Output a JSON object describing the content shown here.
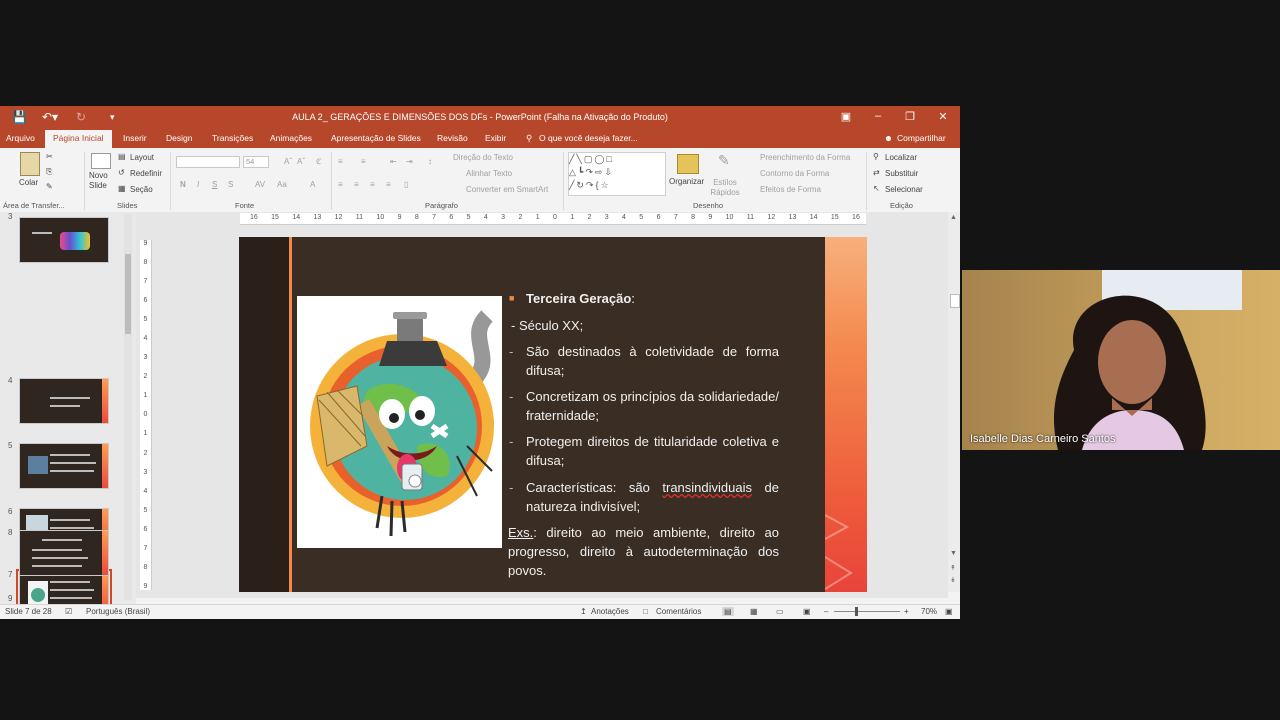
{
  "window": {
    "title": "AULA 2_ GERAÇÕES E DIMENSÕES DOS DFs - PowerPoint (Falha na Ativação do Produto)"
  },
  "menu": {
    "tabs": [
      "Arquivo",
      "Página Inicial",
      "Inserir",
      "Design",
      "Transições",
      "Animações",
      "Apresentação de Slides",
      "Revisão",
      "Exibir"
    ],
    "tell_me": "O que você deseja fazer...",
    "share": "Compartilhar"
  },
  "ribbon": {
    "clipboard": {
      "paste": "Colar",
      "group": "Área de Transfer..."
    },
    "slides": {
      "new_slide": "Novo Slide",
      "layout": "Layout",
      "reset": "Redefinir",
      "section": "Seção",
      "group": "Slides"
    },
    "font": {
      "size": "54",
      "buttons": [
        "N",
        "I",
        "S",
        "S",
        "AV",
        "Aa",
        "A"
      ],
      "group": "Fonte"
    },
    "paragraph": {
      "text_direction": "Direção do Texto",
      "align_text": "Alinhar Texto",
      "smartart": "Converter em SmartArt",
      "group": "Parágrafo"
    },
    "drawing": {
      "arrange": "Organizar",
      "quick_styles": "Estilos Rápidos",
      "fill": "Preenchimento da Forma",
      "outline": "Contorno da Forma",
      "effects": "Efeitos de Forma",
      "group": "Desenho"
    },
    "editing": {
      "find": "Localizar",
      "replace": "Substituir",
      "select": "Selecionar",
      "group": "Edição"
    }
  },
  "ruler": {
    "ticks": [
      "16",
      "15",
      "14",
      "13",
      "12",
      "11",
      "10",
      "9",
      "8",
      "7",
      "6",
      "5",
      "4",
      "3",
      "2",
      "1",
      "0",
      "1",
      "2",
      "3",
      "4",
      "5",
      "6",
      "7",
      "8",
      "9",
      "10",
      "11",
      "12",
      "13",
      "14",
      "15",
      "16"
    ],
    "vticks": [
      "9",
      "8",
      "7",
      "6",
      "5",
      "4",
      "3",
      "2",
      "1",
      "0",
      "1",
      "2",
      "3",
      "4",
      "5",
      "6",
      "7",
      "8",
      "9"
    ]
  },
  "thumbnails": {
    "numbers": [
      "3",
      "4",
      "5",
      "6",
      "7",
      "8",
      "9"
    ],
    "selected": "7"
  },
  "slide": {
    "heading": "Terceira Geração",
    "heading_suffix": ":",
    "century": "-  Século XX;",
    "items": [
      {
        "dash": "-",
        "text": "São destinados à coletividade de forma difusa;"
      },
      {
        "dash": "-",
        "text": "Concretizam os princípios da solidariedade/ fraternidade;"
      },
      {
        "dash": "-",
        "text": "Protegem direitos de titularidade coletiva e difusa;"
      },
      {
        "dash": "-",
        "text_a": "Características: são ",
        "text_b": "transindividuais",
        "text_c": " de natureza indivisível;"
      }
    ],
    "example_label": "Exs.",
    "example_text": ": direito ao meio ambiente, direito ao progresso, direito à autodeterminação dos povos."
  },
  "status": {
    "slide_info": "Slide 7 de 28",
    "language": "Português (Brasil)",
    "notes": "Anotações",
    "comments": "Comentários",
    "zoom": "70%"
  },
  "webcam": {
    "name": "Isabelle Dias Carneiro Santos"
  },
  "colors": {
    "ppt_accent": "#b7472a",
    "slide_bg": "#3a2d24",
    "slide_accent": "#f28a45"
  }
}
